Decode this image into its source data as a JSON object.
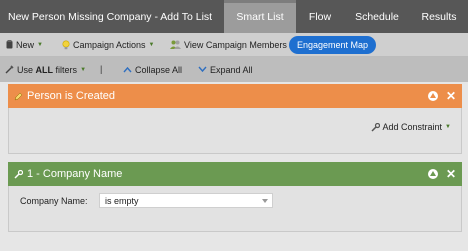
{
  "header": {
    "title": "New Person Missing Company - Add To List",
    "tabs": [
      {
        "label": "Smart List",
        "active": true
      },
      {
        "label": "Flow",
        "active": false
      },
      {
        "label": "Schedule",
        "active": false
      },
      {
        "label": "Results",
        "active": false
      }
    ]
  },
  "toolbar": {
    "new_label": "New",
    "campaign_actions_label": "Campaign Actions",
    "view_members_label": "View Campaign Members",
    "engagement_map_label": "Engagement Map"
  },
  "filterbar": {
    "use_all_prefix": "Use",
    "use_all_bold": "ALL",
    "use_all_suffix": "filters",
    "separator": "|",
    "collapse_label": "Collapse All",
    "expand_label": "Expand All"
  },
  "filters": [
    {
      "title": "Person is Created",
      "add_constraint_label": "Add Constraint",
      "color": "#ed8e4a"
    },
    {
      "title": "1 - Company Name",
      "constraint_label": "Company Name:",
      "constraint_value": "is empty",
      "color": "#6b9a52"
    }
  ],
  "icons": {
    "new": "new-icon",
    "campaign_actions": "lightbulb-icon",
    "view_members": "people-icon",
    "use_all": "filter-icon",
    "collapse": "collapse-icon",
    "expand": "expand-icon",
    "person_created": "pencil-icon",
    "company_name": "wrench-icon",
    "add_constraint": "wrench-icon"
  }
}
